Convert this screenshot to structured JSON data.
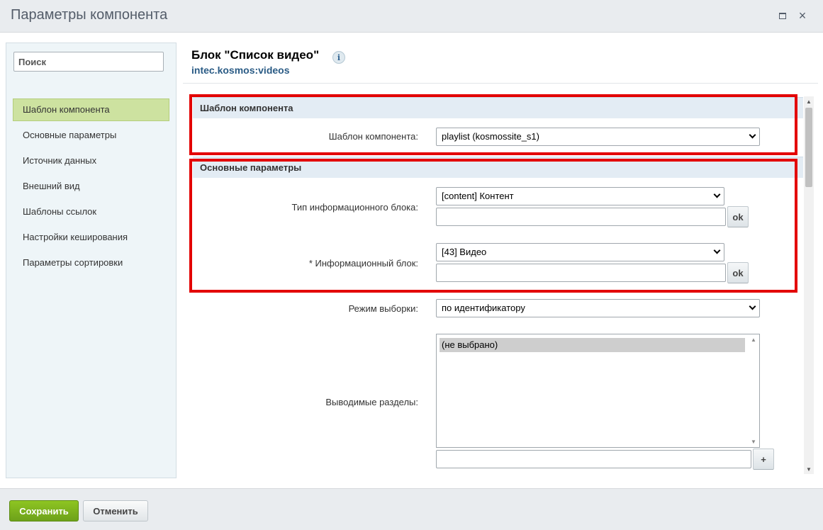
{
  "dialog": {
    "title": "Параметры компонента",
    "maximize_icon": "maximize-icon",
    "close_icon": "close-icon",
    "close_glyph": "×"
  },
  "sidebar": {
    "search_placeholder": "Поиск",
    "items": [
      {
        "label": "Шаблон компонента",
        "active": true
      },
      {
        "label": "Основные параметры",
        "active": false
      },
      {
        "label": "Источник данных",
        "active": false
      },
      {
        "label": "Внешний вид",
        "active": false
      },
      {
        "label": "Шаблоны ссылок",
        "active": false
      },
      {
        "label": "Настройки кеширования",
        "active": false
      },
      {
        "label": "Параметры сортировки",
        "active": false
      }
    ]
  },
  "component": {
    "title": "Блок \"Список видео\"",
    "info_glyph": "i",
    "code": "intec.kosmos:videos"
  },
  "sections": {
    "template": {
      "header": "Шаблон компонента",
      "field_label": "Шаблон компонента:",
      "field_value": "playlist (kosmossite_s1)"
    },
    "main": {
      "header": "Основные параметры",
      "iblock_type_label": "Тип информационного блока:",
      "iblock_type_value": "[content] Контент",
      "iblock_label": "* Информационный блок:",
      "iblock_value": "[43] Видео",
      "ok_label": "ok",
      "select_mode_label": "Режим выборки:",
      "select_mode_value": "по идентификатору",
      "sections_label": "Выводимые разделы:",
      "sections_option": "(не выбрано)",
      "add_label": "+"
    }
  },
  "footer": {
    "save_label": "Сохранить",
    "cancel_label": "Отменить"
  },
  "colors": {
    "highlight": "#e30000",
    "active_nav": "#cde2a0",
    "save_button": "#7cb31e",
    "link": "#2a5b85"
  }
}
